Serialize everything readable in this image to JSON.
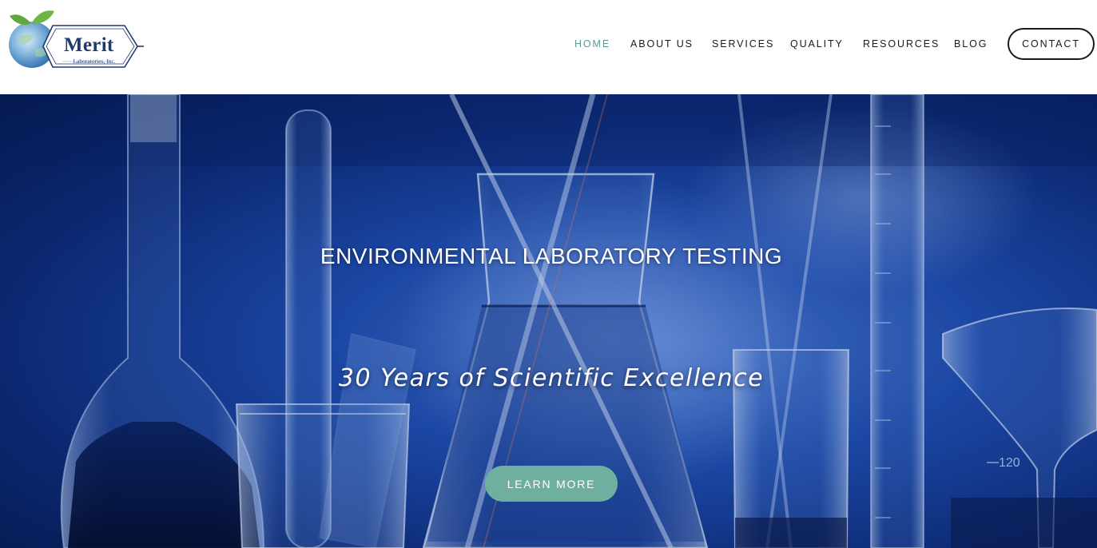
{
  "logo": {
    "name": "Merit",
    "sub": "Laboratories, Inc."
  },
  "nav": {
    "items": [
      {
        "label": "HOME",
        "active": true
      },
      {
        "label": "ABOUT US",
        "active": false
      },
      {
        "label": "SERVICES",
        "active": false
      },
      {
        "label": "QUALITY",
        "active": false
      },
      {
        "label": "RESOURCES",
        "active": false
      },
      {
        "label": "BLOG",
        "active": false
      }
    ],
    "contact_label": "CONTACT"
  },
  "hero": {
    "title": "ENVIRONMENTAL LABORATORY TESTING",
    "subtitle": "30 Years of Scientific Excellence",
    "button_label": "LEARN MORE",
    "scale_marks": [
      "120"
    ]
  },
  "colors": {
    "accent": "#5b9a94",
    "button": "#6eaf9f",
    "logo_blue": "#1f3a6e",
    "hero_blue": "#1f4fb3"
  }
}
